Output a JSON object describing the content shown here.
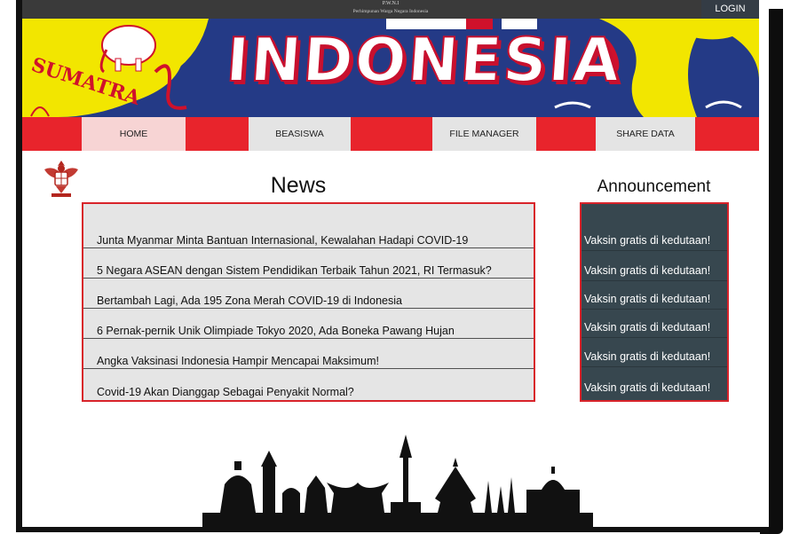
{
  "topbar": {
    "org_short": "P.W.N.I",
    "org_full": "Perhimpunan Warga Negara Indonesia",
    "login_label": "LOGIN"
  },
  "banner": {
    "title": "INDONESIA",
    "map_word": "SUMATRA"
  },
  "nav": {
    "items": [
      {
        "label": "HOME"
      },
      {
        "label": "BEASISWA"
      },
      {
        "label": "FILE MANAGER"
      },
      {
        "label": "SHARE DATA"
      }
    ]
  },
  "news": {
    "heading": "News",
    "items": [
      {
        "title": "Junta Myanmar Minta Bantuan Internasional, Kewalahan Hadapi COVID-19"
      },
      {
        "title": "5 Negara ASEAN dengan Sistem Pendidikan Terbaik Tahun 2021, RI Termasuk?"
      },
      {
        "title": "Bertambah Lagi, Ada 195 Zona Merah COVID-19 di Indonesia"
      },
      {
        "title": "6 Pernak-pernik Unik Olimpiade Tokyo 2020, Ada Boneka Pawang Hujan"
      },
      {
        "title": "Angka Vaksinasi Indonesia Hampir Mencapai Maksimum!"
      },
      {
        "title": "Covid-19 Akan Dianggap Sebagai Penyakit Normal?"
      }
    ]
  },
  "announcement": {
    "heading": "Announcement",
    "items": [
      {
        "text": "Vaksin gratis di kedutaan!"
      },
      {
        "text": "Vaksin gratis di kedutaan!"
      },
      {
        "text": "Vaksin gratis di kedutaan!"
      },
      {
        "text": "Vaksin gratis di kedutaan!"
      },
      {
        "text": "Vaksin gratis di kedutaan!"
      },
      {
        "text": "Vaksin gratis di kedutaan!"
      }
    ]
  },
  "colors": {
    "accent_red": "#e8242c",
    "announcement_bg": "#37474f",
    "banner_blue": "#243a86"
  }
}
